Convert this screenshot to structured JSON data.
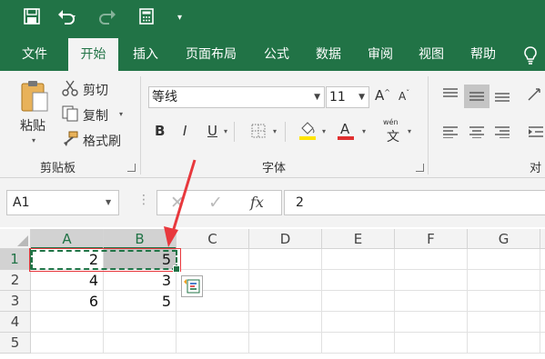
{
  "colors": {
    "brand": "#217346",
    "arrow": "#e8383d",
    "font_color_red": "#e03030",
    "fill_yellow": "#ffe400"
  },
  "quick_access": {
    "icons": [
      "save-icon",
      "undo-icon",
      "redo-icon",
      "form-icon",
      "customize-icon"
    ]
  },
  "tabs": [
    {
      "label": "文件",
      "active": false
    },
    {
      "label": "开始",
      "active": true
    },
    {
      "label": "插入",
      "active": false
    },
    {
      "label": "页面布局",
      "active": false
    },
    {
      "label": "公式",
      "active": false
    },
    {
      "label": "数据",
      "active": false
    },
    {
      "label": "审阅",
      "active": false
    },
    {
      "label": "视图",
      "active": false
    },
    {
      "label": "帮助",
      "active": false
    }
  ],
  "clipboard": {
    "paste": "粘贴",
    "cut": "剪切",
    "copy": "复制",
    "format_painter": "格式刷",
    "label": "剪贴板"
  },
  "font": {
    "name": "等线",
    "size": "11",
    "bold": "B",
    "italic": "I",
    "underline": "U",
    "phonetic_top": "wén",
    "phonetic_char": "文",
    "label": "字体"
  },
  "alignment": {
    "label_partial": "对齐"
  },
  "formula_bar": {
    "name_box": "A1",
    "fx": "fx",
    "value": "2"
  },
  "sheet": {
    "columns": [
      "A",
      "B",
      "C",
      "D",
      "E",
      "F",
      "G"
    ],
    "rows": [
      "1",
      "2",
      "3",
      "4",
      "5"
    ],
    "cells": [
      {
        "ref": "A1",
        "value": "2"
      },
      {
        "ref": "B1",
        "value": "5"
      },
      {
        "ref": "A2",
        "value": "4"
      },
      {
        "ref": "B2",
        "value": "3"
      },
      {
        "ref": "A3",
        "value": "6"
      },
      {
        "ref": "B3",
        "value": "5"
      }
    ],
    "selected_range": "A1:B1",
    "active_cell": "A1"
  }
}
